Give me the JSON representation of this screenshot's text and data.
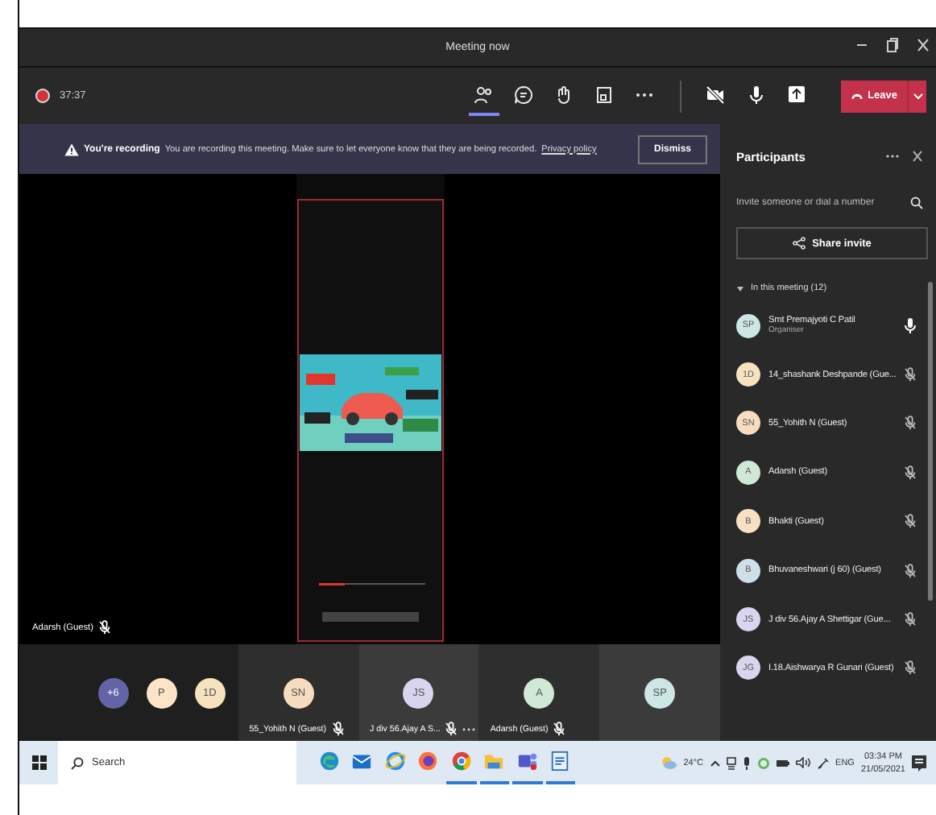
{
  "window": {
    "title": "Meeting now"
  },
  "toolbar": {
    "recording": true,
    "timer": "37:37",
    "buttons": [
      {
        "kind": "people",
        "selected": true
      },
      {
        "kind": "chat",
        "selected": false
      },
      {
        "kind": "hand",
        "selected": false
      },
      {
        "kind": "rooms",
        "selected": false
      },
      {
        "kind": "more",
        "selected": false
      }
    ],
    "camera_on": false,
    "mic_on": true,
    "leave": "Leave"
  },
  "banner": {
    "title": "You're recording",
    "message": "You are recording this meeting. Make sure to let everyone know that they are being recorded.",
    "link": "Privacy policy",
    "dismiss": "Dismiss"
  },
  "stage": {
    "speaker": "Adarsh (Guest)",
    "speaker_muted": true
  },
  "tiles": {
    "overflow": [
      {
        "initials": "+6",
        "color": "#6264a7"
      },
      {
        "initials": "P",
        "color": "#fde4c6"
      },
      {
        "initials": "1D",
        "color": "#f6e2bd"
      }
    ],
    "people": [
      {
        "initials": "SN",
        "color": "#f8dcc0",
        "name": "55_Yohith N (Guest)",
        "muted": true,
        "more": false
      },
      {
        "initials": "JS",
        "color": "#d9d5ef",
        "name": "J div 56.Ajay A S...",
        "muted": true,
        "more": true
      },
      {
        "initials": "A",
        "color": "#cfe9d6",
        "name": "Adarsh (Guest)",
        "muted": true,
        "more": false
      },
      {
        "initials": "SP",
        "color": "#cde6e6"
      }
    ]
  },
  "participants": {
    "title": "Participants",
    "invite_placeholder": "Invite someone or dial a number",
    "share": "Share invite",
    "section": "In this meeting (12)",
    "expanded": true,
    "people": [
      {
        "initials": "SP",
        "color": "#cde6e6",
        "name": "Smt Premajyoti C Patil",
        "role": "Organiser",
        "muted": false
      },
      {
        "initials": "1D",
        "color": "#f6e2bd",
        "name": "14_shashank Deshpande (Gue...",
        "muted": true
      },
      {
        "initials": "SN",
        "color": "#f8dcc0",
        "name": "55_Yohith N (Guest)",
        "muted": true
      },
      {
        "initials": "A",
        "color": "#cfe9d6",
        "name": "Adarsh (Guest)",
        "muted": true
      },
      {
        "initials": "B",
        "color": "#f8e0c2",
        "name": "Bhakti (Guest)",
        "muted": true
      },
      {
        "initials": "B",
        "color": "#cfdfea",
        "name": "Bhuvaneshwari (j 60) (Guest)",
        "muted": true
      },
      {
        "initials": "JS",
        "color": "#d9d5ef",
        "name": "J div 56.Ajay A Shettigar (Gue...",
        "muted": true
      },
      {
        "initials": "JG",
        "color": "#d9d5ef",
        "name": "I.18.Aishwarya R Gunari (Guest)",
        "muted": true
      }
    ]
  },
  "taskbar": {
    "search_placeholder": "Search",
    "apps": [
      {
        "kind": "edge",
        "running": false
      },
      {
        "kind": "mail",
        "running": false
      },
      {
        "kind": "ie",
        "running": false
      },
      {
        "kind": "firefox",
        "running": false
      },
      {
        "kind": "chrome",
        "running": true
      },
      {
        "kind": "folder",
        "running": true
      },
      {
        "kind": "teams",
        "running": true
      },
      {
        "kind": "notepad",
        "running": true
      }
    ],
    "weather": "24°C",
    "language": "ENG",
    "time": "03:34 PM",
    "date": "21/05/2021"
  }
}
